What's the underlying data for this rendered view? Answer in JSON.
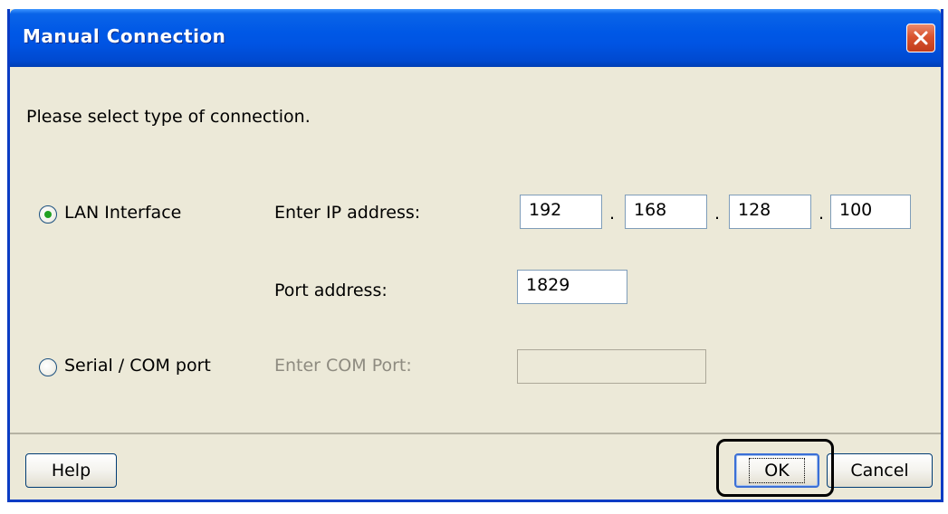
{
  "window": {
    "title": "Manual Connection"
  },
  "instructions": "Please select type of connection.",
  "lan": {
    "radio_label": "LAN Interface",
    "selected": true,
    "ip_label": "Enter IP address:",
    "ip_octets": [
      "192",
      "168",
      "128",
      "100"
    ],
    "ip_separator": ".",
    "port_label": "Port address:",
    "port_value": "1829"
  },
  "serial": {
    "radio_label": "Serial / COM port",
    "selected": false,
    "com_label": "Enter COM Port:",
    "com_value": ""
  },
  "buttons": {
    "help": "Help",
    "ok": "OK",
    "cancel": "Cancel"
  },
  "icons": {
    "close": "close-icon"
  },
  "colors": {
    "titlebar": "#0054e3",
    "close_button": "#d9542f",
    "window_bg": "#ece9d8",
    "radio_dot": "#21a121",
    "highlight_outline": "#000000"
  }
}
